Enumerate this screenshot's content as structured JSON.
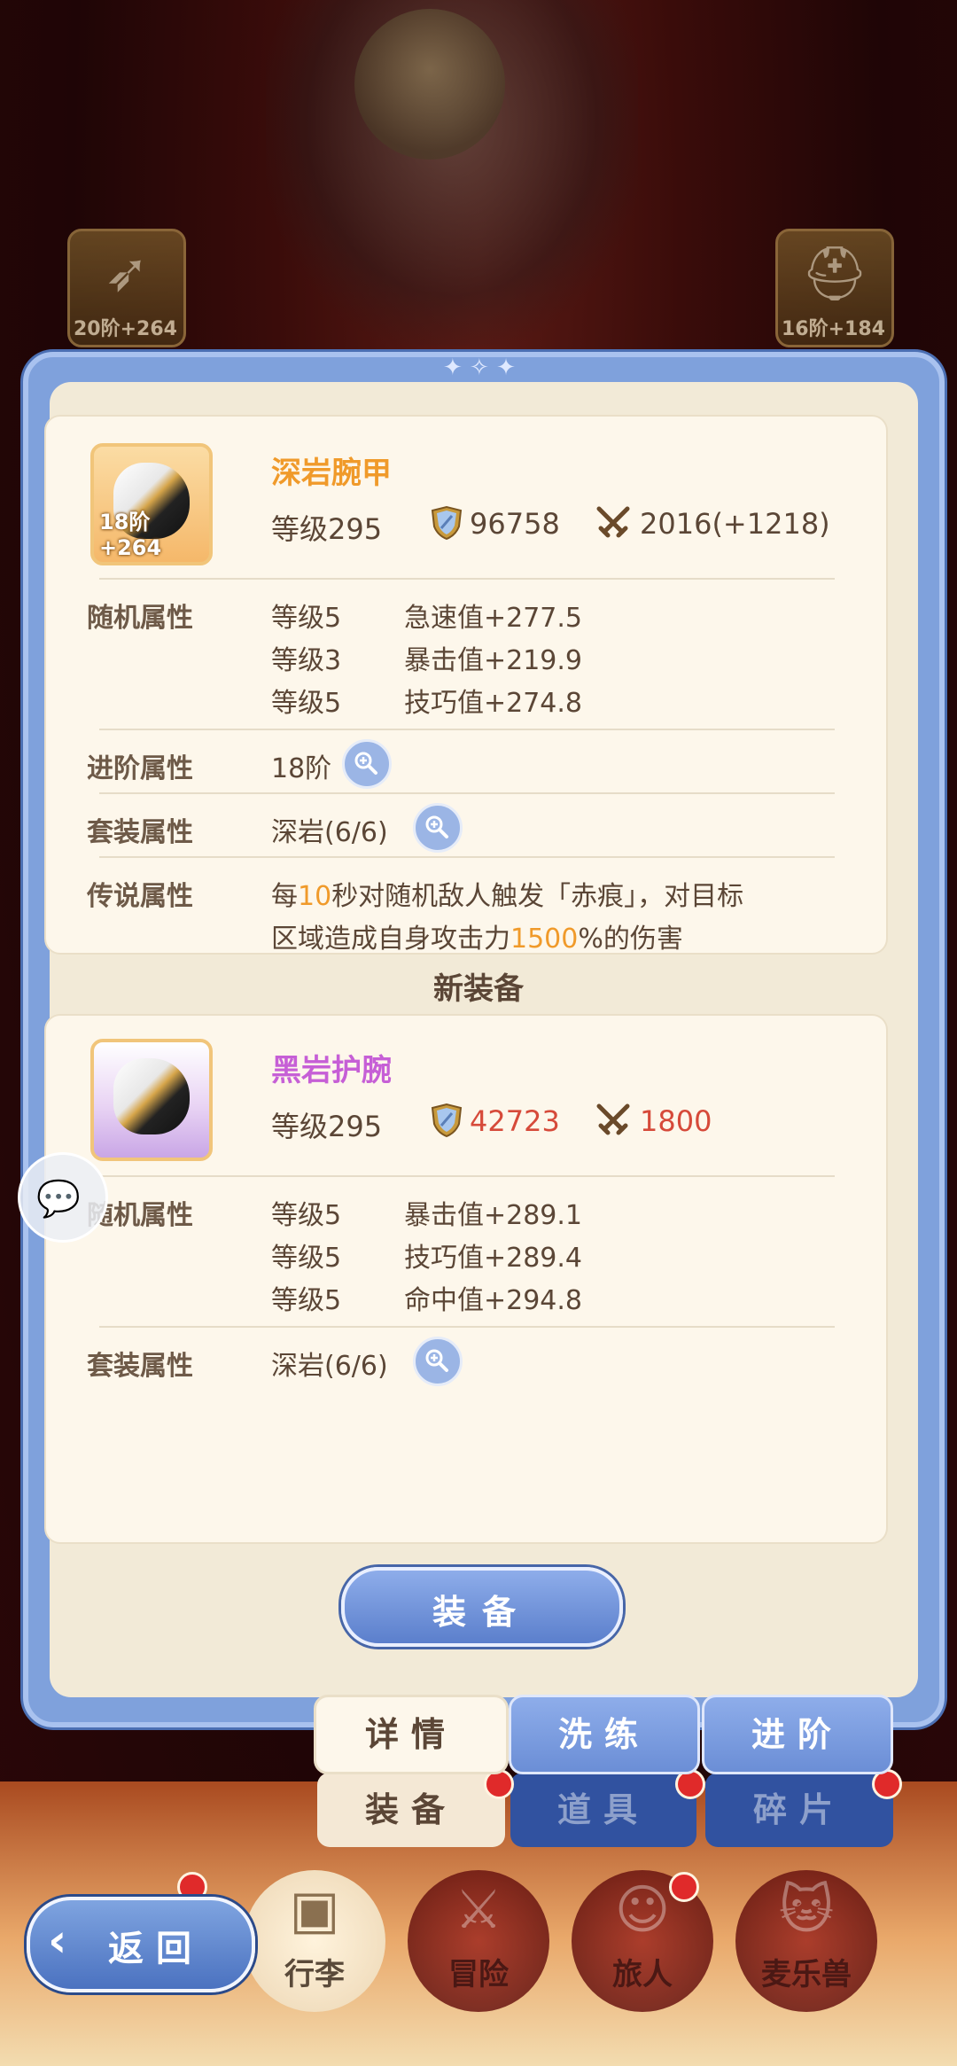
{
  "background": {
    "left_slot_label": "20阶+264",
    "right_slot_label": "16阶+184"
  },
  "current_item": {
    "name": "深岩腕甲",
    "tier_badge": "18阶+264",
    "level": "等级295",
    "defense": "96758",
    "attack": "2016(+1218)",
    "random_label": "随机属性",
    "random_attrs": [
      {
        "level": "等级5",
        "value": "急速值+277.5"
      },
      {
        "level": "等级3",
        "value": "暴击值+219.9"
      },
      {
        "level": "等级5",
        "value": "技巧值+274.8"
      }
    ],
    "advance_label": "进阶属性",
    "advance_value": "18阶",
    "set_label": "套装属性",
    "set_value": "深岩(6/6)",
    "legend_label": "传说属性",
    "legend_line1_prefix": "每",
    "legend_line1_num": "10",
    "legend_line1_suffix": "秒对随机敌人触发「赤痕」，对目标",
    "legend_line2_prefix": "区域造成自身攻击力",
    "legend_line2_num": "1500",
    "legend_line2_suffix": "%的伤害"
  },
  "section_title": "新装备",
  "new_item": {
    "name": "黑岩护腕",
    "level": "等级295",
    "defense": "42723",
    "attack": "1800",
    "random_label": "随机属性",
    "random_attrs": [
      {
        "level": "等级5",
        "value": "暴击值+289.1"
      },
      {
        "level": "等级5",
        "value": "技巧值+289.4"
      },
      {
        "level": "等级5",
        "value": "命中值+294.8"
      }
    ],
    "set_label": "套装属性",
    "set_value": "深岩(6/6)"
  },
  "equip_button": "装备",
  "tabs_top": [
    "详情",
    "洗练",
    "进阶"
  ],
  "tabs_bottom": [
    "装备",
    "道具",
    "碎片"
  ],
  "back_button": "返回",
  "bottom_nav": [
    "行李",
    "冒险",
    "旅人",
    "麦乐兽"
  ],
  "colors": {
    "current_name": "#f09a2a",
    "new_name": "#c65fd6",
    "new_stat_red": "#d64a3a",
    "panel_blue": "#7fa1dc"
  }
}
